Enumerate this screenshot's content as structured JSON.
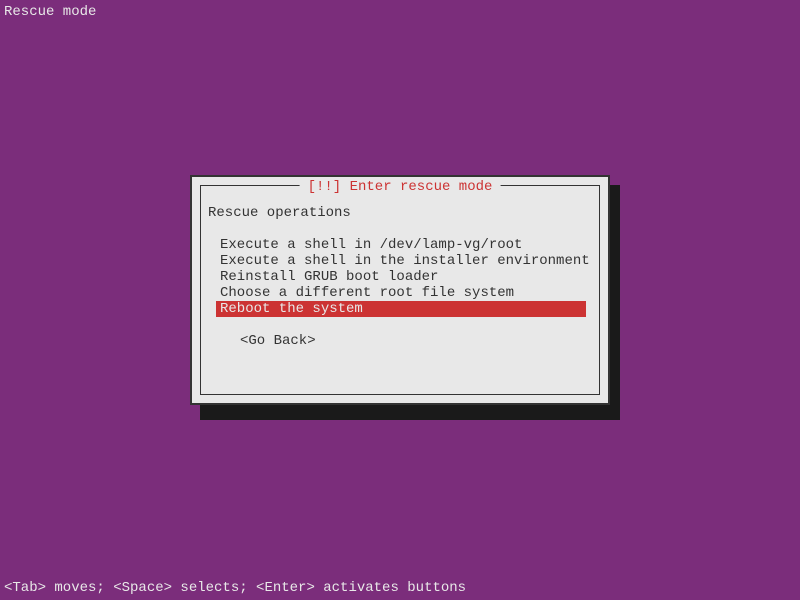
{
  "header": {
    "title": "Rescue mode"
  },
  "dialog": {
    "title": "[!!] Enter rescue mode",
    "section_title": "Rescue operations",
    "menu_items": [
      "Execute a shell in /dev/lamp-vg/root",
      "Execute a shell in the installer environment",
      "Reinstall GRUB boot loader",
      "Choose a different root file system",
      "Reboot the system"
    ],
    "selected_index": 4,
    "go_back": "<Go Back>"
  },
  "footer": {
    "help_text": "<Tab> moves; <Space> selects; <Enter> activates buttons"
  }
}
